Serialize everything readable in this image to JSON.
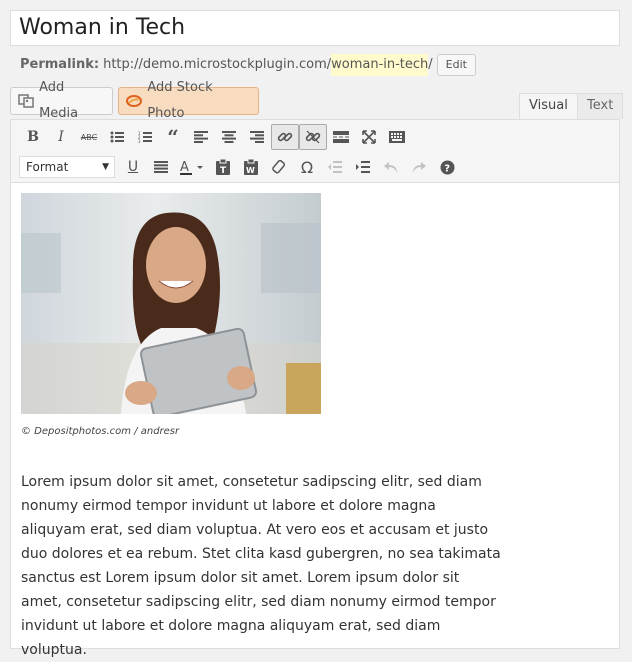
{
  "post": {
    "title": "Woman in Tech",
    "permalink_label": "Permalink:",
    "permalink_base": "http://demo.microstockplugin.com/",
    "permalink_slug": "woman-in-tech",
    "permalink_trail": "/",
    "edit_label": "Edit"
  },
  "media": {
    "add_media_label": "Add Media",
    "add_stock_label": "Add Stock Photo"
  },
  "tabs": {
    "visual": "Visual",
    "text": "Text"
  },
  "toolbar": {
    "format_value": "Format",
    "row1": [
      "bold-icon",
      "italic-icon",
      "strikethrough-icon",
      "bullet-list-icon",
      "numbered-list-icon",
      "blockquote-icon",
      "align-left-icon",
      "align-center-icon",
      "align-right-icon",
      "insert-link-icon",
      "unlink-icon",
      "read-more-icon",
      "fullscreen-icon",
      "toolbar-toggle-icon"
    ],
    "row2": [
      "underline-icon",
      "justify-icon",
      "text-color-icon",
      "paste-text-icon",
      "paste-word-icon",
      "clear-formatting-icon",
      "special-character-icon",
      "outdent-icon",
      "indent-icon",
      "undo-icon",
      "redo-icon",
      "help-icon"
    ]
  },
  "content": {
    "image_credit": "© Depositphotos.com / andresr",
    "paragraph": "Lorem ipsum dolor sit amet, consetetur sadipscing elitr, sed diam nonumy eirmod tempor invidunt ut labore et dolore magna aliquyam erat, sed diam voluptua. At vero eos et accusam et justo duo dolores et ea rebum. Stet clita kasd gubergren, no sea takimata sanctus est Lorem ipsum dolor sit amet. Lorem ipsum dolor sit amet, consetetur sadipscing elitr, sed diam nonumy eirmod tempor invidunt ut labore et dolore magna aliquyam erat, sed diam voluptua."
  },
  "colors": {
    "stock_button_bg": "#f8dcc0",
    "permalink_highlight": "#fffbcc"
  }
}
